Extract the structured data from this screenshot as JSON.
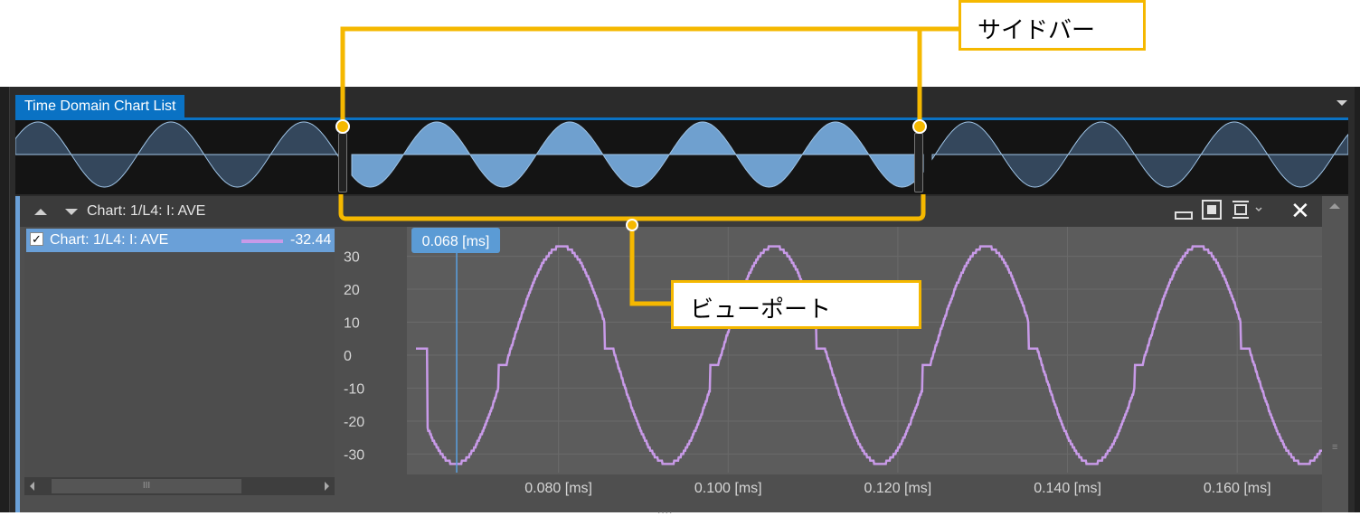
{
  "window": {
    "tab_label": "Time Domain Chart List"
  },
  "panel": {
    "title": "Chart: 1/L4: I: AVE",
    "icons": [
      "minimize-icon",
      "fit-all-icon",
      "fit-vertical-icon",
      "close-icon"
    ]
  },
  "legend": {
    "checked": true,
    "check_glyph": "✓",
    "series_name": "Chart: 1/L4: I: AVE",
    "series_value": "-32.44",
    "series_color": "#c89ae8"
  },
  "scroll": {
    "thumb_glyph": "III",
    "grip_glyph": "≡",
    "bottom_grip_glyph": "...."
  },
  "cursor": {
    "label": "0.068 [ms]",
    "x_ms": 0.068
  },
  "annotations": {
    "sidebar_label": "サイドバー",
    "viewport_label": "ビューポート",
    "color": "#f5b800"
  },
  "colors": {
    "accent_blue": "#0a72c4",
    "overview_fill": "#6fa0cf",
    "overview_dim": "#34475c",
    "cursor_line": "#5aa0e0"
  },
  "chart_data": {
    "type": "line",
    "title": "",
    "xlabel": "",
    "ylabel": "",
    "x_unit": "[ms]",
    "x_tick_labels": [
      "0.080 [ms]",
      "0.100 [ms]",
      "0.120 [ms]",
      "0.140 [ms]",
      "0.160 [ms]"
    ],
    "x_ticks": [
      0.08,
      0.1,
      0.12,
      0.14,
      0.16
    ],
    "xlim": [
      0.0632,
      0.17
    ],
    "y_tick_labels": [
      "30",
      "20",
      "10",
      "0",
      "-10",
      "-20",
      "-30"
    ],
    "y_ticks": [
      30,
      20,
      10,
      0,
      -10,
      -20,
      -30
    ],
    "ylim": [
      -34,
      34
    ],
    "grid": true,
    "series": [
      {
        "name": "Chart: 1/L4: I: AVE",
        "period_ms": 0.025,
        "amplitude": 33,
        "x": [
          0.0632,
          0.0645,
          0.0668,
          0.068,
          0.0705,
          0.073,
          0.0755,
          0.078,
          0.0805,
          0.083,
          0.0855,
          0.088,
          0.0905,
          0.093,
          0.0955,
          0.098,
          0.1005,
          0.103,
          0.1055,
          0.108,
          0.1105,
          0.113,
          0.1155,
          0.118,
          0.1205,
          0.123,
          0.1255,
          0.128,
          0.1305,
          0.133,
          0.1355,
          0.138,
          0.1405,
          0.143,
          0.1455,
          0.148,
          0.1505,
          0.153,
          0.1555,
          0.158,
          0.1605,
          0.163,
          0.1655,
          0.168,
          0.17
        ],
        "y": [
          2,
          2,
          -32,
          -32,
          -3,
          3,
          22,
          33,
          33,
          2,
          2,
          -22,
          -33,
          -20,
          -3,
          3,
          22,
          33,
          33,
          2,
          2,
          -22,
          -33,
          -20,
          -3,
          3,
          22,
          33,
          33,
          2,
          2,
          -22,
          -33,
          -20,
          -3,
          3,
          22,
          33,
          33,
          2,
          2,
          -22,
          -33,
          -25,
          -24
        ]
      }
    ]
  }
}
